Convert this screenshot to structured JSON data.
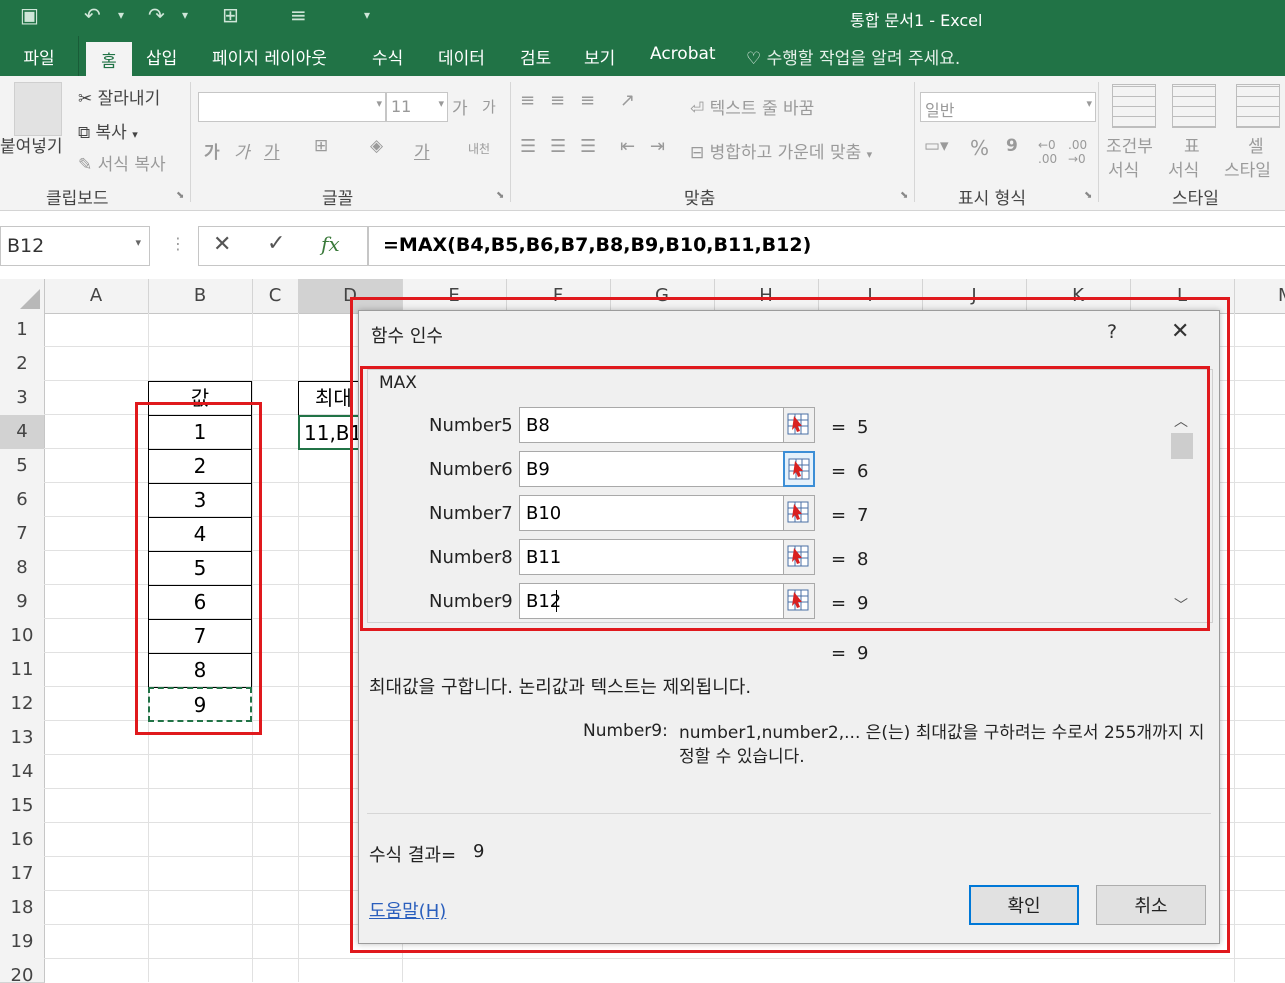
{
  "window": {
    "title": "통합 문서1 - Excel"
  },
  "tabs": [
    "파일",
    "홈",
    "삽입",
    "페이지 레이아웃",
    "수식",
    "데이터",
    "검토",
    "보기",
    "Acrobat"
  ],
  "tell_me": "수행할 작업을 알려 주세요.",
  "ribbon": {
    "clipboard": {
      "paste": "붙여넣기",
      "cut": "잘라내기",
      "copy": "복사",
      "format_painter": "서식 복사",
      "label": "클립보드"
    },
    "font": {
      "size": "11",
      "grow": "가",
      "shrink": "가",
      "bold": "가",
      "italic": "가",
      "underline": "가",
      "font_color": "가",
      "phonetic": "내천",
      "label": "글꼴"
    },
    "alignment": {
      "wrap": "텍스트 줄 바꿈",
      "merge": "병합하고 가운데 맞춤",
      "label": "맞춤"
    },
    "number": {
      "format": "일반",
      "percent": "%",
      "comma": "9",
      "label": "표시 형식"
    },
    "styles": {
      "conditional_1": "조건부",
      "conditional_2": "서식",
      "table_1": "표",
      "table_2": "서식",
      "cell_1": "셀",
      "cell_2": "스타일",
      "label": "스타일"
    }
  },
  "formula_bar": {
    "name_box": "B12",
    "cancel": "✕",
    "enter": "✓",
    "fx": "fx",
    "formula": "=MAX(B4,B5,B6,B7,B8,B9,B10,B11,B12)"
  },
  "columns": [
    "A",
    "B",
    "C",
    "D",
    "E",
    "F",
    "G",
    "H",
    "I",
    "J",
    "K",
    "L",
    "M"
  ],
  "rows": [
    "1",
    "2",
    "3",
    "4",
    "5",
    "6",
    "7",
    "8",
    "9",
    "10",
    "11",
    "12",
    "13",
    "14",
    "15",
    "16",
    "17",
    "18",
    "19",
    "20"
  ],
  "cells": {
    "B3": "값",
    "D3": "최대",
    "D4": "11,B1",
    "B_values": [
      "1",
      "2",
      "3",
      "4",
      "5",
      "6",
      "7",
      "8",
      "9"
    ]
  },
  "dialog": {
    "title": "함수 인수",
    "help": "?",
    "close": "✕",
    "function_name": "MAX",
    "args": [
      {
        "label": "Number5",
        "value": "B8",
        "result": "5"
      },
      {
        "label": "Number6",
        "value": "B9",
        "result": "6"
      },
      {
        "label": "Number7",
        "value": "B10",
        "result": "7"
      },
      {
        "label": "Number8",
        "value": "B11",
        "result": "8"
      },
      {
        "label": "Number9",
        "value": "B12",
        "result": "9"
      }
    ],
    "equals": "=",
    "total_result": "9",
    "description": "최대값을 구합니다. 논리값과 텍스트는 제외됩니다.",
    "arg_desc_label": "Number9:",
    "arg_desc_text": "number1,number2,... 은(는) 최대값을 구하려는 수로서 255개까지 지정할 수 있습니다.",
    "result_label": "수식 결과=",
    "result_value": "9",
    "help_link": "도움말(H)",
    "ok": "확인",
    "cancel": "취소"
  }
}
